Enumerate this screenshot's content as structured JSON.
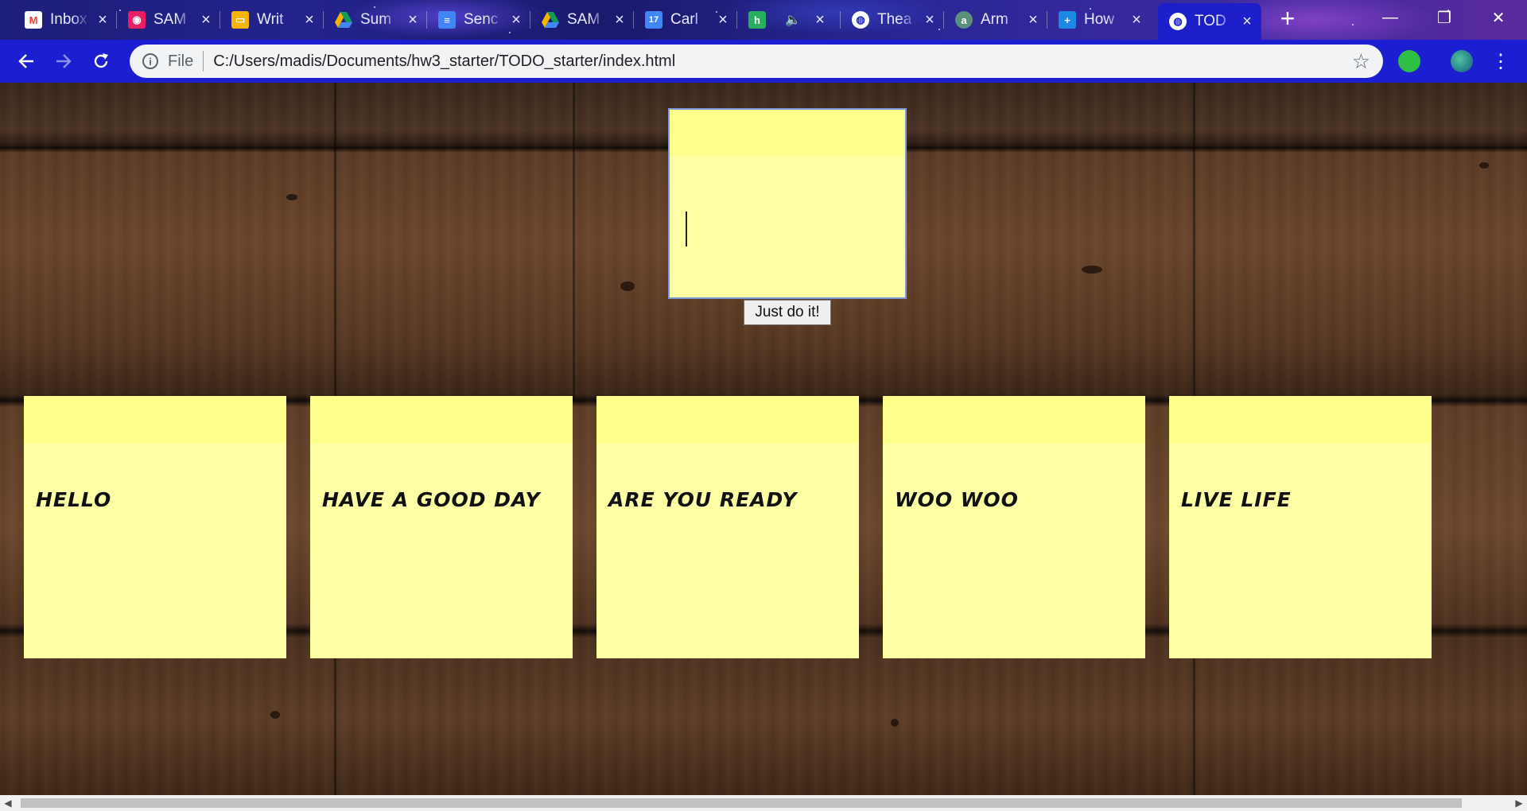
{
  "browser": {
    "tabs": [
      {
        "title": "Inbox",
        "favicon": "gmail-icon",
        "color": "#ea4335"
      },
      {
        "title": "SAM",
        "favicon": "contacts-icon",
        "color": "#e91e63"
      },
      {
        "title": "Writ",
        "favicon": "slides-icon",
        "color": "#f4b400"
      },
      {
        "title": "Sum",
        "favicon": "drive-icon",
        "color": "#0f9d58"
      },
      {
        "title": "Senc",
        "favicon": "docs-icon",
        "color": "#4285f4"
      },
      {
        "title": "SAM",
        "favicon": "drive-icon",
        "color": "#0f9d58"
      },
      {
        "title": "Carl",
        "favicon": "calendar-icon",
        "color": "#4285f4"
      },
      {
        "title": "",
        "favicon": "h-icon",
        "color": "#27ae60",
        "muted": true
      },
      {
        "title": "Thea",
        "favicon": "globe-icon",
        "color": "#ffffff"
      },
      {
        "title": "Arm",
        "favicon": "arm-icon",
        "color": "#5a8f7b"
      },
      {
        "title": "How",
        "favicon": "plus-icon",
        "color": "#1e88e5"
      },
      {
        "title": "TOD",
        "favicon": "globe-icon",
        "color": "#ffffff",
        "active": true
      }
    ],
    "address": {
      "scheme_label": "File",
      "url": "C:/Users/madis/Documents/hw3_starter/TODO_starter/index.html"
    }
  },
  "todo": {
    "input_value": "",
    "submit_label": "Just do it!",
    "notes": [
      "HELLO",
      "HAVE A GOOD DAY",
      "ARE YOU READY",
      "WOO WOO",
      "LIVE LIFE"
    ]
  },
  "colors": {
    "note": "#ffffa6",
    "note_band": "#ffff8c",
    "toolbar": "#1b1fd1"
  }
}
